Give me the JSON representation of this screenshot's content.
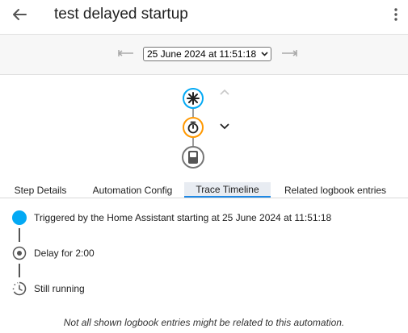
{
  "header": {
    "title": "test delayed startup"
  },
  "date_bar": {
    "selected": "25 June 2024 at 11:51:18"
  },
  "tabs": [
    {
      "label": "Step Details"
    },
    {
      "label": "Automation Config"
    },
    {
      "label": "Trace Timeline"
    },
    {
      "label": "Related logbook entries"
    }
  ],
  "active_tab": "Trace Timeline",
  "timeline": [
    {
      "text": "Triggered by the Home Assistant starting at 25 June 2024 at 11:51:18",
      "icon": "trigger-dot-icon"
    },
    {
      "text": "Delay for 2:00",
      "icon": "radio-dot-icon"
    },
    {
      "text": "Still running",
      "icon": "progress-clock-icon"
    }
  ],
  "footnote": "Not all shown logbook entries might be related to this automation.",
  "colors": {
    "accent": "#03a9f4",
    "delay": "#ff9800",
    "tab_underline": "#1e88e5"
  }
}
